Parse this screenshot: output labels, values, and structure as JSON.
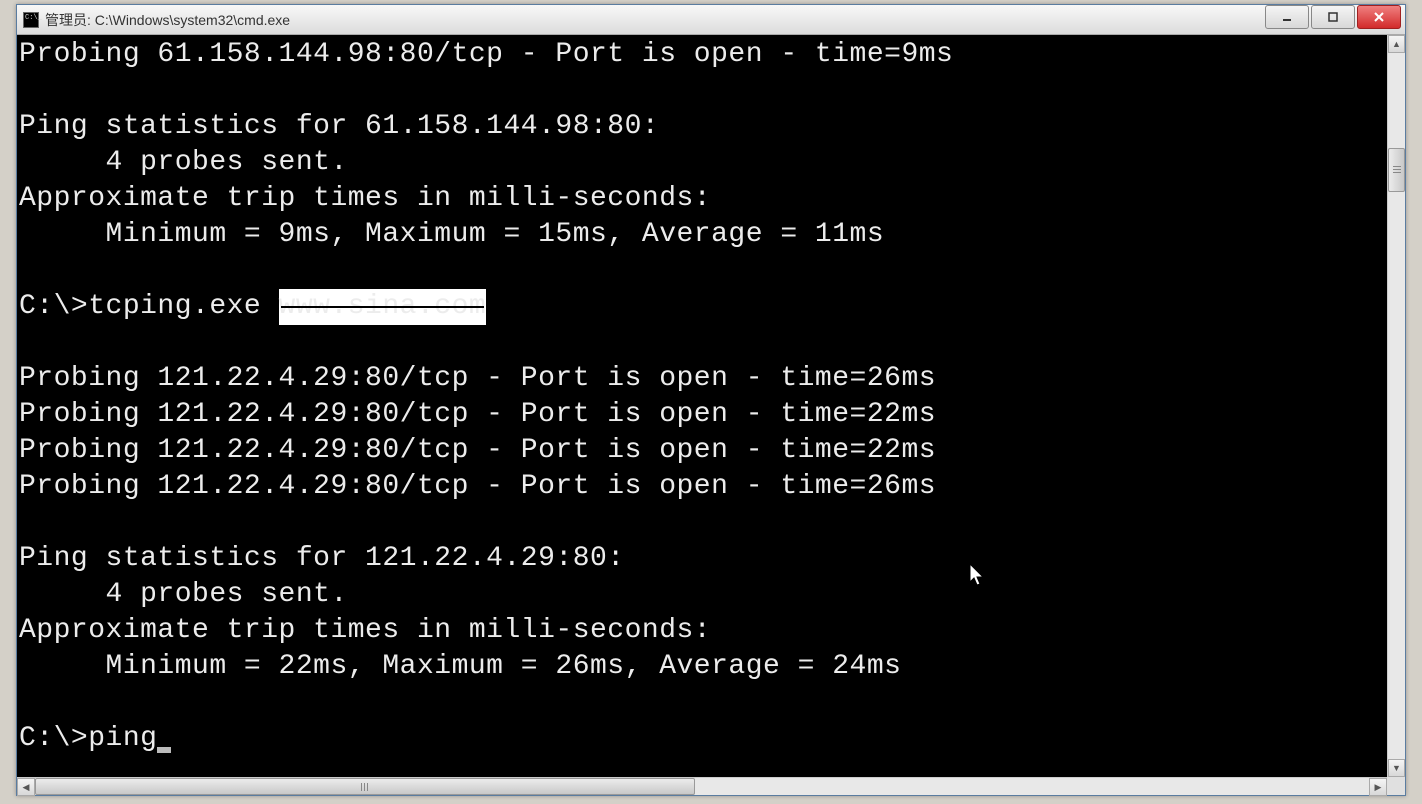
{
  "window": {
    "title": "管理员: C:\\Windows\\system32\\cmd.exe"
  },
  "terminal": {
    "lines": [
      "Probing 61.158.144.98:80/tcp - Port is open - time=9ms",
      "",
      "Ping statistics for 61.158.144.98:80:",
      "     4 probes sent.",
      "Approximate trip times in milli-seconds:",
      "     Minimum = 9ms, Maximum = 15ms, Average = 11ms",
      "",
      "",
      "",
      "Probing 121.22.4.29:80/tcp - Port is open - time=26ms",
      "Probing 121.22.4.29:80/tcp - Port is open - time=22ms",
      "Probing 121.22.4.29:80/tcp - Port is open - time=22ms",
      "Probing 121.22.4.29:80/tcp - Port is open - time=26ms",
      "",
      "Ping statistics for 121.22.4.29:80:",
      "     4 probes sent.",
      "Approximate trip times in milli-seconds:",
      "     Minimum = 22ms, Maximum = 26ms, Average = 24ms",
      ""
    ],
    "command_prefix": "C:\\>tcping.exe ",
    "redacted_arg": "www.sina.com",
    "prompt_prefix": "C:\\>ping"
  }
}
